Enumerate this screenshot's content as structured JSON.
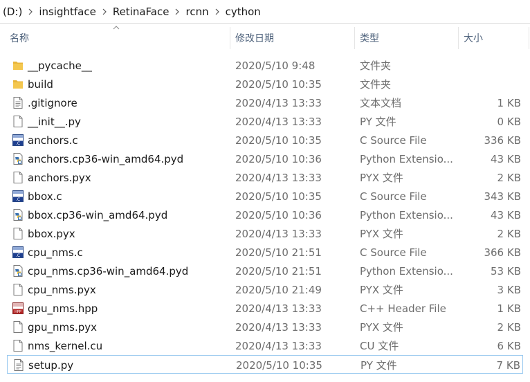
{
  "address": {
    "drive": "(D:)",
    "crumbs": [
      "insightface",
      "RetinaFace",
      "rcnn",
      "cython"
    ]
  },
  "columns": {
    "name": "名称",
    "date": "修改日期",
    "type": "类型",
    "size": "大小"
  },
  "files": [
    {
      "name": "__pycache__",
      "date": "2020/5/10 9:48",
      "type": "文件夹",
      "size": "",
      "icon": "folder-icon"
    },
    {
      "name": "build",
      "date": "2020/5/10 10:35",
      "type": "文件夹",
      "size": "",
      "icon": "folder-icon"
    },
    {
      "name": ".gitignore",
      "date": "2020/4/13 13:33",
      "type": "文本文档",
      "size": "1 KB",
      "icon": "text-file-icon"
    },
    {
      "name": "__init__.py",
      "date": "2020/4/13 13:33",
      "type": "PY 文件",
      "size": "0 KB",
      "icon": "blank-file-icon"
    },
    {
      "name": "anchors.c",
      "date": "2020/5/10 10:35",
      "type": "C Source File",
      "size": "336 KB",
      "icon": "c-source-icon"
    },
    {
      "name": "anchors.cp36-win_amd64.pyd",
      "date": "2020/5/10 10:36",
      "type": "Python Extensio...",
      "size": "43 KB",
      "icon": "python-ext-icon"
    },
    {
      "name": "anchors.pyx",
      "date": "2020/4/13 13:33",
      "type": "PYX 文件",
      "size": "2 KB",
      "icon": "blank-file-icon"
    },
    {
      "name": "bbox.c",
      "date": "2020/5/10 10:35",
      "type": "C Source File",
      "size": "343 KB",
      "icon": "c-source-icon"
    },
    {
      "name": "bbox.cp36-win_amd64.pyd",
      "date": "2020/5/10 10:36",
      "type": "Python Extensio...",
      "size": "43 KB",
      "icon": "python-ext-icon"
    },
    {
      "name": "bbox.pyx",
      "date": "2020/4/13 13:33",
      "type": "PYX 文件",
      "size": "2 KB",
      "icon": "blank-file-icon"
    },
    {
      "name": "cpu_nms.c",
      "date": "2020/5/10 21:51",
      "type": "C Source File",
      "size": "366 KB",
      "icon": "c-source-icon"
    },
    {
      "name": "cpu_nms.cp36-win_amd64.pyd",
      "date": "2020/5/10 21:51",
      "type": "Python Extensio...",
      "size": "53 KB",
      "icon": "python-ext-icon"
    },
    {
      "name": "cpu_nms.pyx",
      "date": "2020/5/10 21:49",
      "type": "PYX 文件",
      "size": "3 KB",
      "icon": "blank-file-icon"
    },
    {
      "name": "gpu_nms.hpp",
      "date": "2020/4/13 13:33",
      "type": "C++ Header File",
      "size": "1 KB",
      "icon": "hpp-file-icon"
    },
    {
      "name": "gpu_nms.pyx",
      "date": "2020/4/13 13:33",
      "type": "PYX 文件",
      "size": "2 KB",
      "icon": "blank-file-icon"
    },
    {
      "name": "nms_kernel.cu",
      "date": "2020/4/13 13:33",
      "type": "CU 文件",
      "size": "6 KB",
      "icon": "blank-file-icon"
    },
    {
      "name": "setup.py",
      "date": "2020/5/10 10:35",
      "type": "PY 文件",
      "size": "7 KB",
      "icon": "text-file-icon"
    }
  ],
  "selected_index": 16,
  "colors": {
    "header_text": "#4c607a",
    "selection_border": "#99c9ef",
    "secondary_text": "#6d6d6d",
    "folder": "#e8b53b"
  }
}
